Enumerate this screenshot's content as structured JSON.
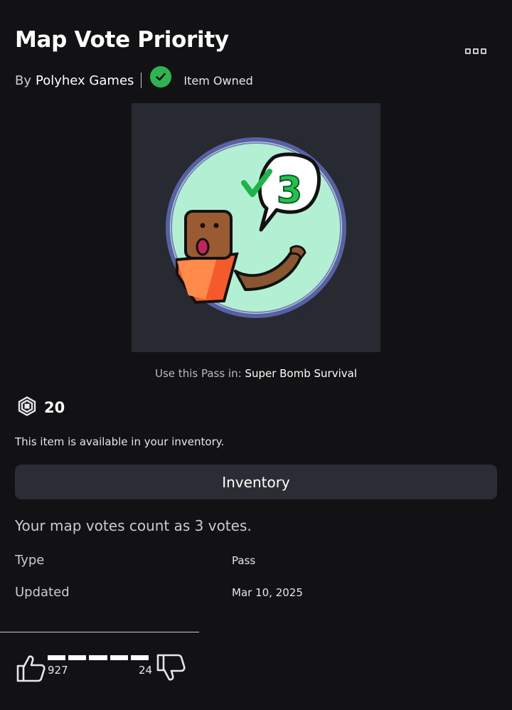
{
  "item": {
    "title": "Map Vote Priority",
    "by_prefix": "By",
    "creator": "Polyhex Games",
    "owned_label": "Item Owned"
  },
  "use_pass": {
    "prefix": "Use this Pass in:",
    "game": "Super Bomb Survival"
  },
  "price": {
    "value": "20",
    "currency_icon": "robux-icon"
  },
  "availability": "This item is available in your inventory.",
  "inventory_button": "Inventory",
  "description": "Your map votes count as 3 votes.",
  "details": [
    {
      "label": "Type",
      "value": "Pass"
    },
    {
      "label": "Updated",
      "value": "Mar 10, 2025"
    }
  ],
  "votes": {
    "up": "927",
    "down": "24"
  },
  "thumbnail": {
    "badge_text": "3"
  },
  "colors": {
    "background": "#121215",
    "panel": "#2b2d35",
    "owned_green": "#2fb453"
  }
}
